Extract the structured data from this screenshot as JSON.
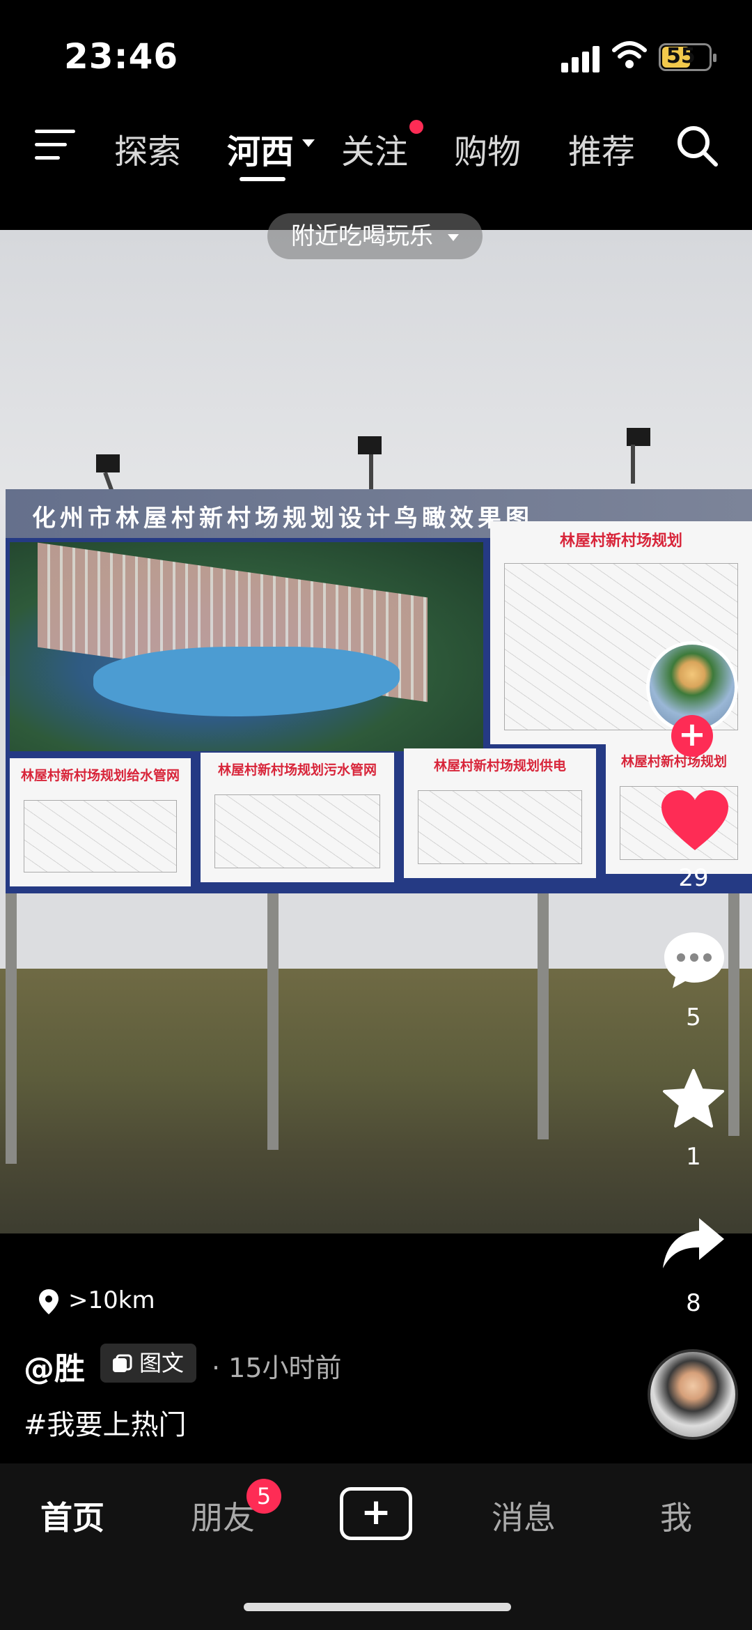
{
  "status_bar": {
    "time": "23:46",
    "battery": "55"
  },
  "top_nav": {
    "tabs": [
      {
        "label": "探索"
      },
      {
        "label": "河西",
        "active": true
      },
      {
        "label": "关注",
        "has_dot": true
      },
      {
        "label": "购物"
      },
      {
        "label": "推荐"
      }
    ],
    "icons": {
      "menu": "menu-icon",
      "search": "search-icon",
      "dropdown": "caret-down-icon"
    }
  },
  "nearby_pill": {
    "label": "附近吃喝玩乐"
  },
  "video": {
    "billboard_title": "化州市林屋村新村场规划设计鸟瞰效果图",
    "panels": [
      "林屋村新村场规划",
      "林屋村新村场规划给水管网",
      "林屋村新村场规划污水管网",
      "林屋村新村场规划供电",
      "林屋村新村场规划"
    ]
  },
  "actions": {
    "like_count": "29",
    "comment_count": "5",
    "favorite_count": "1",
    "share_count": "8"
  },
  "post": {
    "location": ">10km",
    "author": "@胜",
    "type_label": "图文",
    "time": "· 15小时前",
    "hashtag": "#我要上热门"
  },
  "bottom_nav": {
    "home": "首页",
    "friends": "朋友",
    "friends_badge": "5",
    "messages": "消息",
    "me": "我"
  },
  "colors": {
    "accent": "#fe2c55",
    "background": "#000000"
  }
}
